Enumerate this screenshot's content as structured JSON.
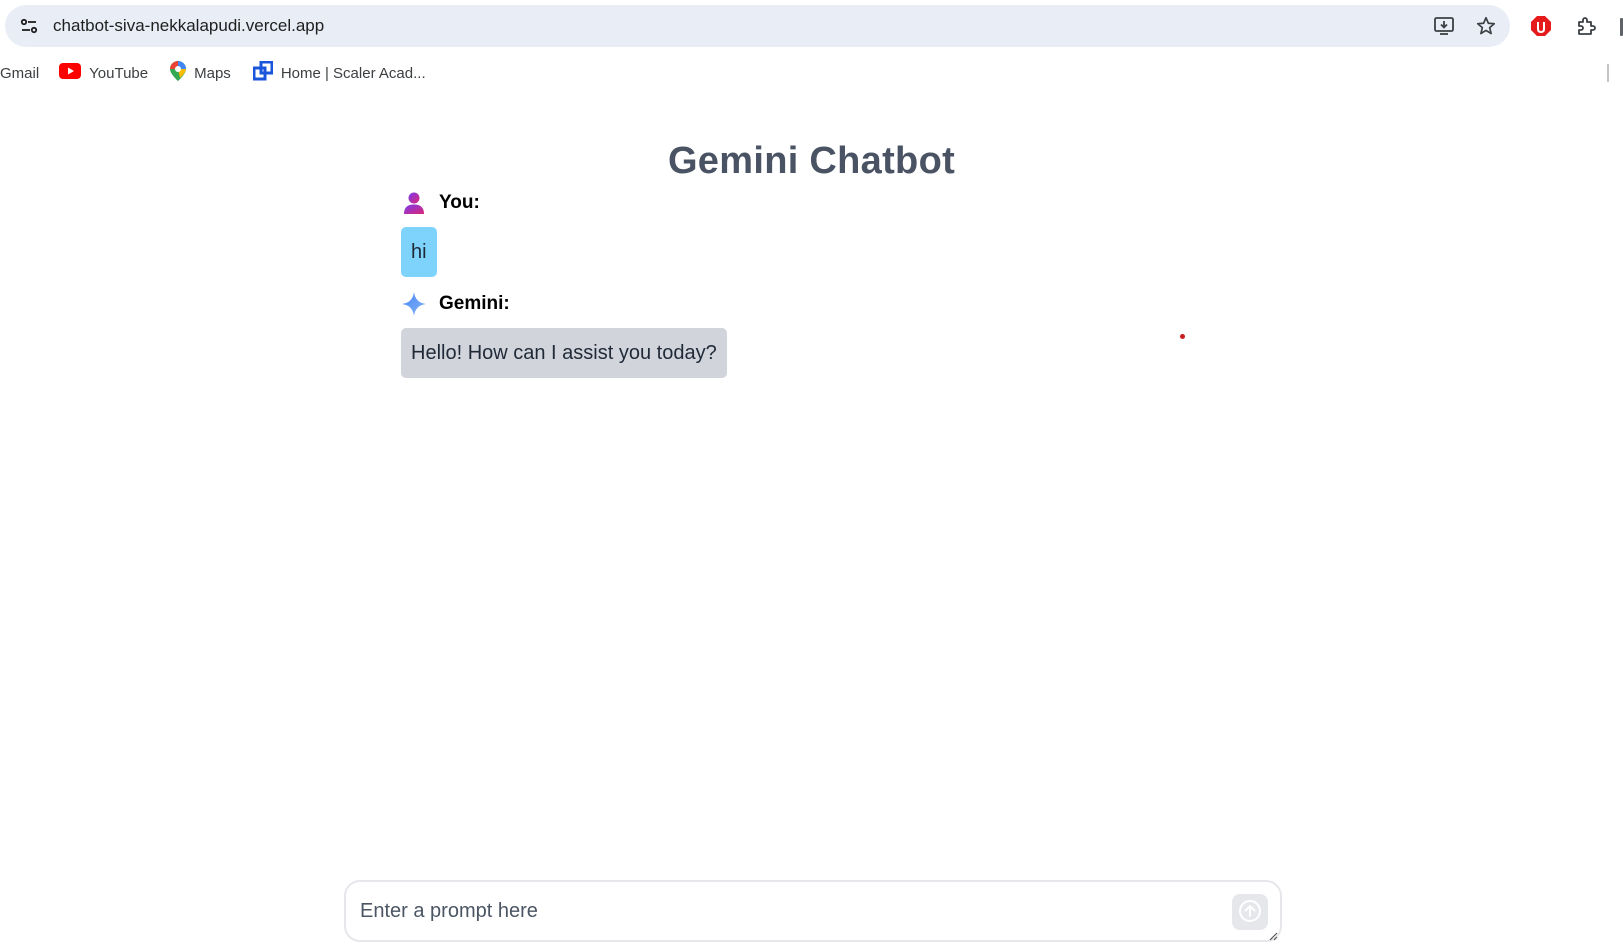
{
  "browser": {
    "url": "chatbot-siva-nekkalapudi.vercel.app",
    "icons": [
      "site-settings-icon",
      "install-app-icon",
      "bookmark-star-icon",
      "extension-stop-icon",
      "extensions-puzzle-icon"
    ],
    "bookmarks": [
      {
        "label": "Gmail",
        "icon": "gmail-icon"
      },
      {
        "label": "YouTube",
        "icon": "youtube-icon"
      },
      {
        "label": "Maps",
        "icon": "maps-icon"
      },
      {
        "label": "Home | Scaler Acad...",
        "icon": "scaler-icon"
      }
    ]
  },
  "page": {
    "title": "Gemini Chatbot"
  },
  "messages": [
    {
      "sender": "You:",
      "icon": "user-icon",
      "text": "hi",
      "bubble_color": "#7dd3fc"
    },
    {
      "sender": "Gemini:",
      "icon": "gemini-sparkle-icon",
      "text": "Hello! How can I assist you today?",
      "bubble_color": "#d1d5db"
    }
  ],
  "composer": {
    "placeholder": "Enter a prompt here",
    "value": "",
    "send_icon": "arrow-up-icon"
  },
  "colors": {
    "title": "#4a5363",
    "omnibox": "#e9eef6",
    "user_bubble": "#7dd3fc",
    "bot_bubble": "#d1d5db"
  }
}
